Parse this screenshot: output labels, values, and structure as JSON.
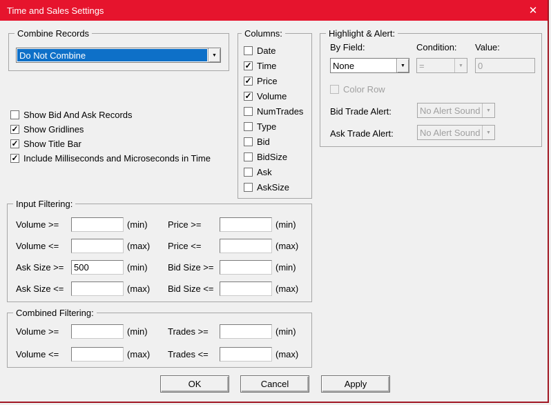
{
  "window": {
    "title": "Time and Sales Settings"
  },
  "icons": {
    "close": "✕",
    "check": "✓",
    "dropdown_arrow": "▼"
  },
  "colors": {
    "titlebar_red": "#E6142D",
    "selection_blue": "#0E70C8",
    "dialog_bg": "#F0F0F0",
    "disabled_text": "#A0A0A0",
    "border_red": "#A01622"
  },
  "combine_records": {
    "group_label": "Combine Records",
    "selected_option": "Do Not Combine"
  },
  "display_options": {
    "items": [
      {
        "label": "Show Bid And Ask Records",
        "checked": false
      },
      {
        "label": "Show Gridlines",
        "checked": true
      },
      {
        "label": "Show Title Bar",
        "checked": true
      },
      {
        "label": "Include Milliseconds and Microseconds in Time",
        "checked": true
      }
    ]
  },
  "columns": {
    "group_label": "Columns:",
    "items": [
      {
        "label": "Date",
        "checked": false
      },
      {
        "label": "Time",
        "checked": true
      },
      {
        "label": "Price",
        "checked": true
      },
      {
        "label": "Volume",
        "checked": true
      },
      {
        "label": "NumTrades",
        "checked": false
      },
      {
        "label": "Type",
        "checked": false
      },
      {
        "label": "Bid",
        "checked": false
      },
      {
        "label": "BidSize",
        "checked": false
      },
      {
        "label": "Ask",
        "checked": false
      },
      {
        "label": "AskSize",
        "checked": false
      }
    ]
  },
  "highlight_alert": {
    "group_label": "Highlight & Alert:",
    "by_field_label": "By Field:",
    "by_field_value": "None",
    "condition_label": "Condition:",
    "condition_value": "=",
    "value_label": "Value:",
    "value_value": "0",
    "color_row_label": "Color Row",
    "color_row_checked": false,
    "bid_trade_alert_label": "Bid Trade Alert:",
    "bid_trade_alert_value": "No Alert Sound",
    "ask_trade_alert_label": "Ask Trade Alert:",
    "ask_trade_alert_value": "No Alert Sound"
  },
  "input_filtering": {
    "group_label": "Input Filtering:",
    "rows": [
      {
        "l_label": "Volume >=",
        "l_value": "",
        "l_suffix": "(min)",
        "r_label": "Price >=",
        "r_value": "",
        "r_suffix": "(min)"
      },
      {
        "l_label": "Volume <=",
        "l_value": "",
        "l_suffix": "(max)",
        "r_label": "Price <=",
        "r_value": "",
        "r_suffix": "(max)"
      },
      {
        "l_label": "Ask Size >=",
        "l_value": "500",
        "l_suffix": "(min)",
        "r_label": "Bid Size >=",
        "r_value": "",
        "r_suffix": "(min)"
      },
      {
        "l_label": "Ask Size <=",
        "l_value": "",
        "l_suffix": "(max)",
        "r_label": "Bid Size <=",
        "r_value": "",
        "r_suffix": "(max)"
      }
    ]
  },
  "combined_filtering": {
    "group_label": "Combined Filtering:",
    "rows": [
      {
        "l_label": "Volume >=",
        "l_value": "",
        "l_suffix": "(min)",
        "r_label": "Trades >=",
        "r_value": "",
        "r_suffix": "(min)"
      },
      {
        "l_label": "Volume <=",
        "l_value": "",
        "l_suffix": "(max)",
        "r_label": "Trades <=",
        "r_value": "",
        "r_suffix": "(max)"
      }
    ]
  },
  "buttons": {
    "ok": "OK",
    "cancel": "Cancel",
    "apply": "Apply"
  }
}
